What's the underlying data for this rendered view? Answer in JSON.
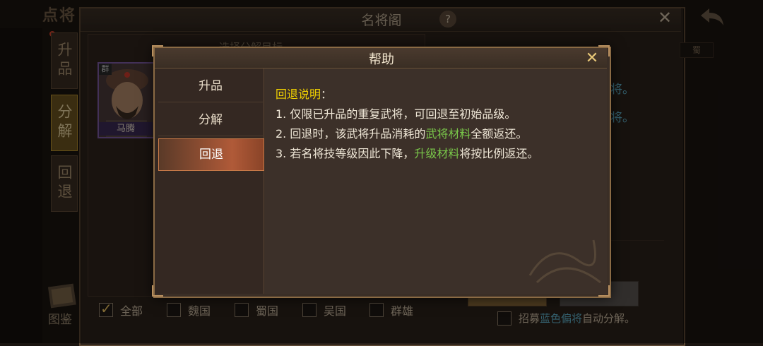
{
  "background": {
    "page_title_partial": "点将",
    "window_title": "名将阁",
    "help_icon_label": "?",
    "close_label": "✕",
    "side_tabs": [
      {
        "label": "升品",
        "active": false
      },
      {
        "label": "分解",
        "active": true
      },
      {
        "label": "回退",
        "active": false
      }
    ],
    "partial_header_text": "选择分解目标",
    "general_card": {
      "name": "马腾",
      "faction": "群"
    },
    "filters": [
      {
        "label": "全部",
        "checked": true
      },
      {
        "label": "魏国",
        "checked": false
      },
      {
        "label": "蜀国",
        "checked": false
      },
      {
        "label": "吴国",
        "checked": false
      },
      {
        "label": "群雄",
        "checked": false
      }
    ],
    "auto_decompose": {
      "prefix": "招募",
      "highlight": "蓝色偏将",
      "suffix": "自动分解。"
    },
    "right_partials": [
      "将。",
      "将。"
    ],
    "right_faction_tag": "蜀",
    "atlas_label": "图鉴"
  },
  "help_dialog": {
    "title": "帮助",
    "close_label": "✕",
    "nav_items": [
      {
        "label": "升品",
        "active": false
      },
      {
        "label": "分解",
        "active": false
      },
      {
        "label": "回退",
        "active": true
      }
    ],
    "heading": "回退说明",
    "heading_colon": "：",
    "lines": [
      {
        "parts": [
          {
            "text": "1. 仅限已升品的重复武将，可回退至初始品级。",
            "green": false
          }
        ]
      },
      {
        "parts": [
          {
            "text": "2. 回退时，该武将升品消耗的",
            "green": false
          },
          {
            "text": "武将材料",
            "green": true
          },
          {
            "text": "全额返还。",
            "green": false
          }
        ]
      },
      {
        "parts": [
          {
            "text": "3. 若名将技等级因此下降，",
            "green": false
          },
          {
            "text": "升级材料",
            "green": true
          },
          {
            "text": "将按比例返还。",
            "green": false
          }
        ]
      }
    ]
  },
  "colors": {
    "heading_yellow": "#f0d000",
    "material_green": "#7ac84a",
    "active_tab_orange": "#b05a38",
    "frame_gold": "#8a6a44"
  }
}
